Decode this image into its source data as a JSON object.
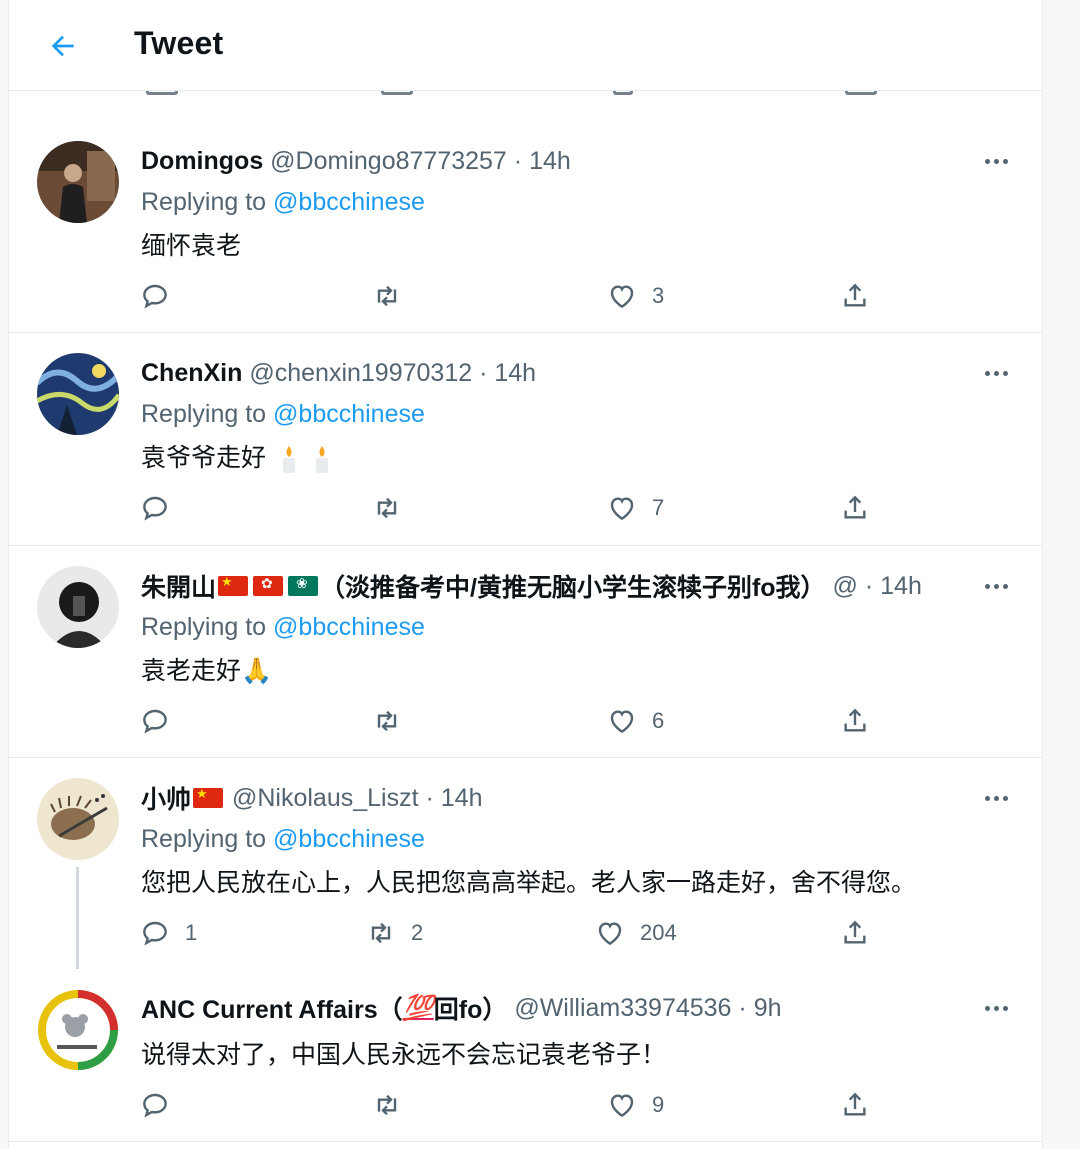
{
  "header": {
    "title": "Tweet"
  },
  "tweets": [
    {
      "name": "Domingos",
      "handle": "@Domingo87773257",
      "dot": "·",
      "time": "14h",
      "replying_prefix": "Replying to",
      "replying_to": "@bbcchinese",
      "text": "缅怀袁老",
      "reply_count": "",
      "retweet_count": "",
      "like_count": "3"
    },
    {
      "name": "ChenXin",
      "handle": "@chenxin19970312",
      "dot": "·",
      "time": "14h",
      "replying_prefix": "Replying to",
      "replying_to": "@bbcchinese",
      "text": "袁爷爷走好",
      "reply_count": "",
      "retweet_count": "",
      "like_count": "7"
    },
    {
      "name": "朱開山",
      "name_suffix": "（淡推备考中/黄推无脑小学生滚犊子别fo我）",
      "handle": "@",
      "dot": "·",
      "time": "14h",
      "replying_prefix": "Replying to",
      "replying_to": "@bbcchinese",
      "text": "袁老走好🙏",
      "reply_count": "",
      "retweet_count": "",
      "like_count": "6"
    },
    {
      "name": "小帅",
      "handle": "@Nikolaus_Liszt",
      "dot": "·",
      "time": "14h",
      "replying_prefix": "Replying to",
      "replying_to": "@bbcchinese",
      "text": "您把人民放在心上，人民把您高高举起。老人家一路走好，舍不得您。",
      "reply_count": "1",
      "retweet_count": "2",
      "like_count": "204"
    },
    {
      "name": "ANC Current Affairs（",
      "name_hundred": "💯",
      "name_end": "回fo）",
      "handle": "@William33974536",
      "dot": "·",
      "time": "9h",
      "text": "说得太对了，中国人民永远不会忘记袁老爷子！",
      "reply_count": "",
      "retweet_count": "",
      "like_count": "9"
    }
  ],
  "colors": {
    "accent": "#1d9bf0",
    "muted": "#536471",
    "border": "#e6ecf0"
  }
}
